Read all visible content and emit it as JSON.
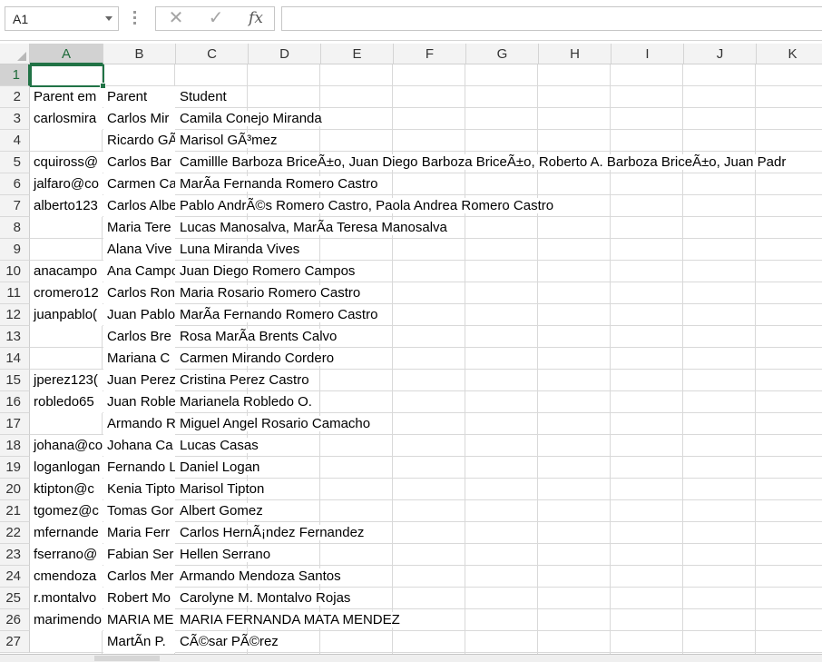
{
  "formula_bar": {
    "name_box": "A1",
    "cancel_glyph": "✕",
    "enter_glyph": "✓",
    "fx_label": "fx",
    "formula": ""
  },
  "columns": [
    "A",
    "B",
    "C",
    "D",
    "E",
    "F",
    "G",
    "H",
    "I",
    "J",
    "K"
  ],
  "rows": [
    "1",
    "2",
    "3",
    "4",
    "5",
    "6",
    "7",
    "8",
    "9",
    "10",
    "11",
    "12",
    "13",
    "14",
    "15",
    "16",
    "17",
    "18",
    "19",
    "20",
    "21",
    "22",
    "23",
    "24",
    "25",
    "26",
    "27"
  ],
  "active_cell": "A1",
  "accent_color": "#217346",
  "cells": {
    "r2": {
      "a": "Parent em",
      "b": "Parent",
      "c": "Student"
    },
    "r3": {
      "a": "carlosmira",
      "b": "Carlos Mir",
      "c": "Camila Conejo Miranda"
    },
    "r4": {
      "a": "",
      "b": "Ricardo GÃ",
      "c": "Marisol GÃ³mez"
    },
    "r5": {
      "a": "cquiross@",
      "b": "Carlos Bar",
      "c": "Camillle Barboza BriceÃ±o, Juan Diego Barboza BriceÃ±o, Roberto A. Barboza BriceÃ±o, Juan Padr"
    },
    "r6": {
      "a": "jalfaro@co",
      "b": "Carmen Ca",
      "c": "MarÃ­a Fernanda Romero Castro"
    },
    "r7": {
      "a": "alberto123",
      "b": "Carlos Albe",
      "c": "Pablo AndrÃ©s Romero Castro, Paola Andrea Romero Castro"
    },
    "r8": {
      "a": "",
      "b": "Maria Tere",
      "c": "Lucas Manosalva, MarÃ­a Teresa Manosalva"
    },
    "r9": {
      "a": "",
      "b": "Alana Vive",
      "c": "Luna Miranda Vives"
    },
    "r10": {
      "a": "anacampo",
      "b": "Ana Campo",
      "c": "Juan Diego Romero Campos"
    },
    "r11": {
      "a": "cromero12",
      "b": "Carlos Ron",
      "c": "Maria Rosario Romero Castro"
    },
    "r12": {
      "a": "juanpablo(",
      "b": "Juan Pablo",
      "c": "MarÃ­a Fernando Romero Castro"
    },
    "r13": {
      "a": "",
      "b": "Carlos Bre",
      "c": "Rosa MarÃ­a Brents Calvo"
    },
    "r14": {
      "a": "",
      "b": "Mariana C",
      "c": "Carmen Mirando Cordero"
    },
    "r15": {
      "a": "jperez123(",
      "b": "Juan Perez",
      "c": "Cristina Perez Castro"
    },
    "r16": {
      "a": "robledo65",
      "b": "Juan Roble",
      "c": "Marianela Robledo O."
    },
    "r17": {
      "a": "",
      "b": "Armando R",
      "c": "Miguel Angel Rosario Camacho"
    },
    "r18": {
      "a": "johana@co",
      "b": "Johana Ca",
      "c": "Lucas Casas"
    },
    "r19": {
      "a": "loganlogan",
      "b": "Fernando L",
      "c": "Daniel Logan"
    },
    "r20": {
      "a": "ktipton@c",
      "b": "Kenia Tipto",
      "c": "Marisol Tipton"
    },
    "r21": {
      "a": "tgomez@c",
      "b": "Tomas Gor",
      "c": "Albert Gomez"
    },
    "r22": {
      "a": "mfernande",
      "b": "Maria Ferr",
      "c": "Carlos HernÃ¡ndez Fernandez"
    },
    "r23": {
      "a": "fserrano@",
      "b": "Fabian Ser",
      "c": "Hellen Serrano"
    },
    "r24": {
      "a": "cmendoza",
      "b": "Carlos Mer",
      "c": "Armando Mendoza Santos"
    },
    "r25": {
      "a": "r.montalvo",
      "b": "Robert Mo",
      "c": "Carolyne M. Montalvo Rojas"
    },
    "r26": {
      "a": "marimendo",
      "b": "MARIA ME",
      "c": "MARIA FERNANDA MATA MENDEZ"
    },
    "r27": {
      "a": "",
      "b": "MartÃ­n P.",
      "c": "CÃ©sar PÃ©rez"
    }
  }
}
